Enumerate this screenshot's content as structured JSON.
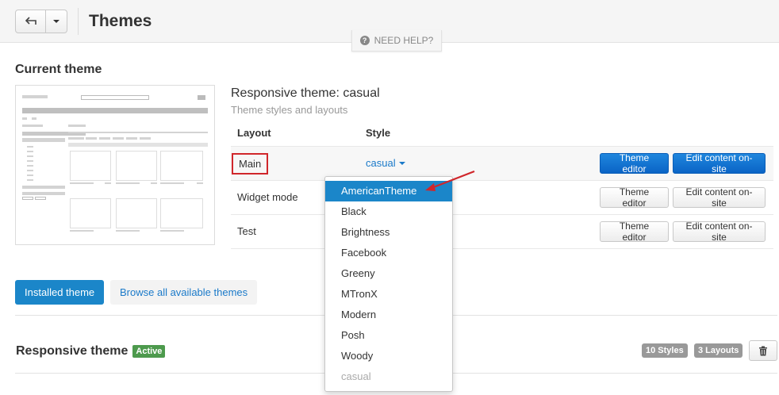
{
  "header": {
    "title": "Themes",
    "help_label": "NEED HELP?"
  },
  "current_theme": {
    "section_title": "Current theme",
    "theme_name": "Responsive theme: casual",
    "subtitle": "Theme styles and layouts",
    "columns": {
      "layout": "Layout",
      "style": "Style"
    },
    "rows": [
      {
        "layout": "Main",
        "style": "casual",
        "editor": "Theme editor",
        "content": "Edit content on-site"
      },
      {
        "layout": "Widget mode",
        "editor": "Theme editor",
        "content": "Edit content on-site"
      },
      {
        "layout": "Test",
        "editor": "Theme editor",
        "content": "Edit content on-site"
      }
    ]
  },
  "style_dropdown": {
    "options": [
      "AmericanTheme",
      "Black",
      "Brightness",
      "Facebook",
      "Greeny",
      "MTronX",
      "Modern",
      "Posh",
      "Woody",
      "casual"
    ],
    "highlighted": "AmericanTheme",
    "current": "casual"
  },
  "tabs": {
    "installed": "Installed theme",
    "browse": "Browse all available themes"
  },
  "installed_theme": {
    "title": "Responsive theme",
    "status": "Active",
    "styles_count": "10 Styles",
    "layouts_count": "3 Layouts"
  },
  "colors": {
    "primary": "#1b86c9",
    "link": "#1b7ac9",
    "active_badge": "#4d9a4d",
    "annotation_red": "#d0262b"
  }
}
